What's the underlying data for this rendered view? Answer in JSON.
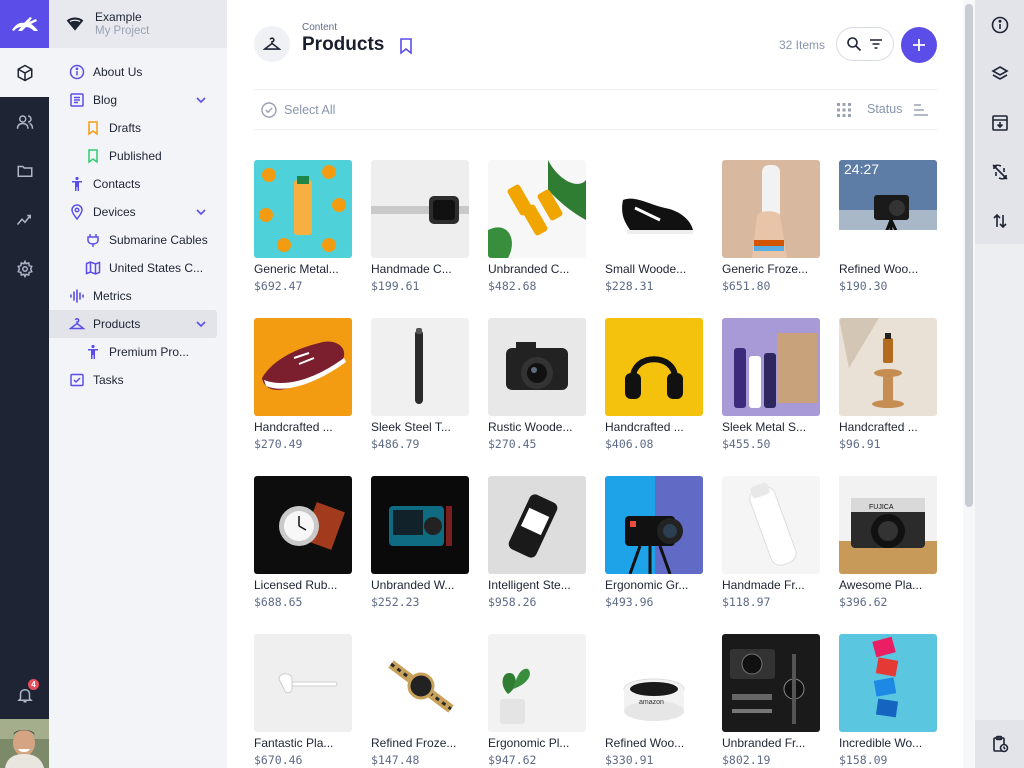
{
  "project": {
    "name": "Example",
    "subtitle": "My Project"
  },
  "notifications": {
    "count": "4"
  },
  "sidebar": {
    "items": [
      {
        "label": "About Us"
      },
      {
        "label": "Blog"
      },
      {
        "label": "Drafts"
      },
      {
        "label": "Published"
      },
      {
        "label": "Contacts"
      },
      {
        "label": "Devices"
      },
      {
        "label": "Submarine Cables"
      },
      {
        "label": "United States C..."
      },
      {
        "label": "Metrics"
      },
      {
        "label": "Products"
      },
      {
        "label": "Premium Pro..."
      },
      {
        "label": "Tasks"
      }
    ]
  },
  "header": {
    "breadcrumb": "Content",
    "title": "Products",
    "count": "32 Items"
  },
  "toolbar": {
    "select_all": "Select All",
    "status": "Status"
  },
  "products": [
    {
      "name": "Generic Metal...",
      "price": "$692.47"
    },
    {
      "name": "Handmade C...",
      "price": "$199.61"
    },
    {
      "name": "Unbranded C...",
      "price": "$482.68"
    },
    {
      "name": "Small Woode...",
      "price": "$228.31"
    },
    {
      "name": "Generic Froze...",
      "price": "$651.80"
    },
    {
      "name": "Refined Woo...",
      "price": "$190.30"
    },
    {
      "name": "Handcrafted ...",
      "price": "$270.49"
    },
    {
      "name": "Sleek Steel T...",
      "price": "$486.79"
    },
    {
      "name": "Rustic Woode...",
      "price": "$270.45"
    },
    {
      "name": "Handcrafted ...",
      "price": "$406.08"
    },
    {
      "name": "Sleek Metal S...",
      "price": "$455.50"
    },
    {
      "name": "Handcrafted ...",
      "price": "$96.91"
    },
    {
      "name": "Licensed Rub...",
      "price": "$688.65"
    },
    {
      "name": "Unbranded W...",
      "price": "$252.23"
    },
    {
      "name": "Intelligent Ste...",
      "price": "$958.26"
    },
    {
      "name": "Ergonomic Gr...",
      "price": "$493.96"
    },
    {
      "name": "Handmade Fr...",
      "price": "$118.97"
    },
    {
      "name": "Awesome Pla...",
      "price": "$396.62"
    },
    {
      "name": "Fantastic Pla...",
      "price": "$670.46"
    },
    {
      "name": "Refined Froze...",
      "price": "$147.48"
    },
    {
      "name": "Ergonomic Pl...",
      "price": "$947.62"
    },
    {
      "name": "Refined Woo...",
      "price": "$330.91"
    },
    {
      "name": "Unbranded Fr...",
      "price": "$802.19"
    },
    {
      "name": "Incredible Wo...",
      "price": "$158.09"
    }
  ],
  "colors": {
    "accent": "#5b4ee8",
    "rail": "#1e2433",
    "sidebar": "#f3f4f7"
  }
}
